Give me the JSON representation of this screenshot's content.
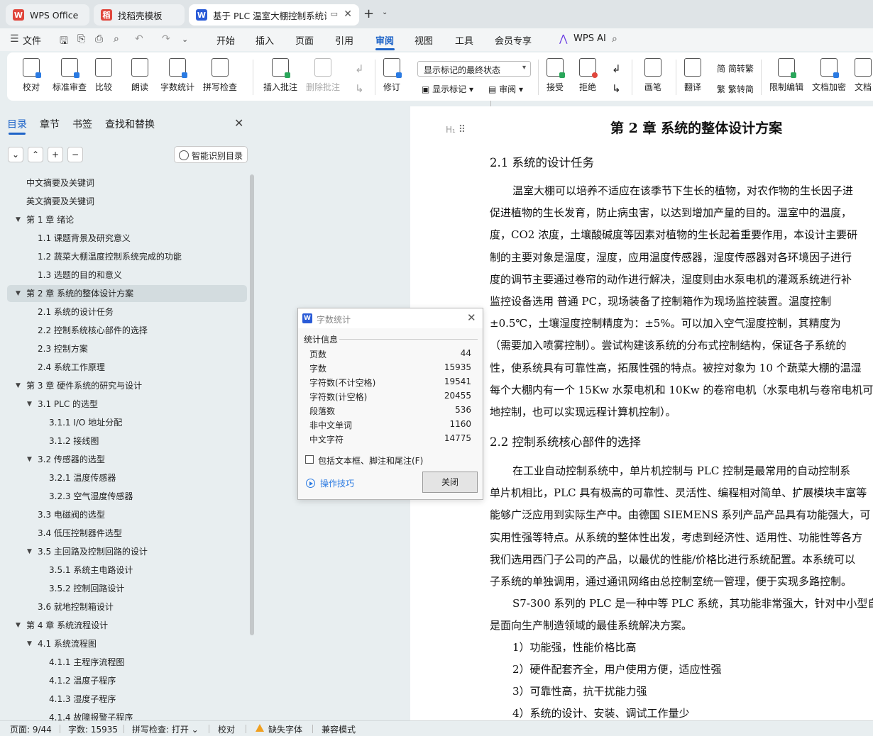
{
  "tabs": [
    {
      "label": "WPS Office",
      "logo": "W",
      "color": "#e0463c"
    },
    {
      "label": "找稻壳模板",
      "logo": "稻",
      "color": "#e0463c"
    },
    {
      "label": "基于 PLC 温室大棚控制系统设",
      "logo": "W",
      "color": "#2a5bd7"
    }
  ],
  "menubar": {
    "file": "文件",
    "items": [
      "开始",
      "插入",
      "页面",
      "引用",
      "审阅",
      "视图",
      "工具",
      "会员专享"
    ],
    "wps_ai": "WPS AI"
  },
  "ribbon": {
    "proofread": "校对",
    "standard_review": "标准审查",
    "compare": "比较",
    "read_aloud": "朗读",
    "word_count": "字数统计",
    "spell_check": "拼写检查",
    "insert_comment": "插入批注",
    "delete_comment": "删除批注",
    "revise": "修订",
    "markup_select": "显示标记的最终状态",
    "show_markup": "显示标记",
    "review": "审阅",
    "accept": "接受",
    "reject": "拒绝",
    "brush": "画笔",
    "translate": "翻译",
    "to_traditional": "简转繁",
    "to_simplified": "繁转简",
    "restrict_edit": "限制编辑",
    "encrypt": "文档加密",
    "doc_more": "文档"
  },
  "panel": {
    "tabs": [
      "目录",
      "章节",
      "书签",
      "查找和替换"
    ],
    "smart_toc": "智能识别目录",
    "toc": [
      {
        "label": "中文摘要及关键词",
        "level": 0,
        "tri": false
      },
      {
        "label": "英文摘要及关键词",
        "level": 0,
        "tri": false
      },
      {
        "label": "第 1 章  绪论",
        "level": 0,
        "tri": true
      },
      {
        "label": "1.1  课题背景及研究意义",
        "level": 1,
        "tri": false
      },
      {
        "label": "1.2  蔬菜大棚温度控制系统完成的功能",
        "level": 1,
        "tri": false
      },
      {
        "label": "1.3  选题的目的和意义",
        "level": 1,
        "tri": false
      },
      {
        "label": "第 2 章  系统的整体设计方案",
        "level": 0,
        "tri": true,
        "selected": true
      },
      {
        "label": "2.1 系统的设计任务",
        "level": 1,
        "tri": false
      },
      {
        "label": "2.2  控制系统核心部件的选择",
        "level": 1,
        "tri": false
      },
      {
        "label": "2.3 控制方案",
        "level": 1,
        "tri": false
      },
      {
        "label": "2.4 系统工作原理",
        "level": 1,
        "tri": false
      },
      {
        "label": "第 3 章  硬件系统的研究与设计",
        "level": 0,
        "tri": true
      },
      {
        "label": "3.1 PLC 的选型",
        "level": 1,
        "tri": true
      },
      {
        "label": "3.1.1 I/O 地址分配",
        "level": 2,
        "tri": false
      },
      {
        "label": "3.1.2  接线图",
        "level": 2,
        "tri": false
      },
      {
        "label": "3.2  传感器的选型",
        "level": 1,
        "tri": true
      },
      {
        "label": "3.2.1 温度传感器",
        "level": 2,
        "tri": false
      },
      {
        "label": "3.2.3  空气湿度传感器",
        "level": 2,
        "tri": false
      },
      {
        "label": "3.3  电磁阀的选型",
        "level": 1,
        "tri": false
      },
      {
        "label": "3.4 低压控制器件选型",
        "level": 1,
        "tri": false
      },
      {
        "label": "3.5 主回路及控制回路的设计",
        "level": 1,
        "tri": true
      },
      {
        "label": "3.5.1  系统主电路设计",
        "level": 2,
        "tri": false
      },
      {
        "label": "3.5.2  控制回路设计",
        "level": 2,
        "tri": false
      },
      {
        "label": "3.6  就地控制箱设计",
        "level": 1,
        "tri": false
      },
      {
        "label": "第 4 章  系统流程设计",
        "level": 0,
        "tri": true
      },
      {
        "label": "4.1 系统流程图",
        "level": 1,
        "tri": true
      },
      {
        "label": "4.1.1  主程序流程图",
        "level": 2,
        "tri": false
      },
      {
        "label": "4.1.2  温度子程序",
        "level": 2,
        "tri": false
      },
      {
        "label": "4.1.3  湿度子程序",
        "level": 2,
        "tri": false
      },
      {
        "label": "4.1.4  故障报警子程序",
        "level": 2,
        "tri": false
      }
    ]
  },
  "document": {
    "h1_marker": "H₁",
    "chapter_title": "第 2 章  系统的整体设计方案",
    "section1": "2.1 系统的设计任务",
    "para1": [
      "温室大棚可以培养不适应在该季节下生长的植物，对农作物的生长因子进",
      "促进植物的生长发育，防止病虫害，以达到增加产量的目的。温室中的温度，",
      "度，CO2 浓度，土壤酸碱度等因素对植物的生长起着重要作用，本设计主要研",
      "制的主要对象是温度，湿度，应用温度传感器，湿度传感器对各环境因子进行",
      "度的调节主要通过卷帘的动作进行解决，湿度则由水泵电机的灌溉系统进行补",
      "监控设备选用 普通 PC，现场装备了控制箱作为现场监控装置。温度控制",
      "±0.5℃，土壤湿度控制精度为：±5%。可以加入空气湿度控制，其精度为",
      "（需要加入喷雾控制）。尝试构建该系统的分布式控制结构，保证各子系统的",
      "性，使系统具有可靠性高，拓展性强的特点。被控对象为 10 个蔬菜大棚的温湿",
      "每个大棚内有一个 15Kw 水泵电机和 10Kw 的卷帘电机（水泵电机与卷帘电机可",
      "地控制，也可以实现远程计算机控制）。"
    ],
    "section2": "2.2  控制系统核心部件的选择",
    "para2": [
      "在工业自动控制系统中，单片机控制与 PLC 控制是最常用的自动控制系",
      "单片机相比，PLC 具有极高的可靠性、灵活性、编程相对简单、扩展模块丰富等",
      "能够广泛应用到实际生产中。由德国 SIEMENS 系列产品产品具有功能强大，可",
      "实用性强等特点。从系统的整体性出发，考虑到经济性、适用性、功能性等各方",
      "我们选用西门子公司的产品，以最优的性能/价格比进行系统配置。本系统可以",
      "子系统的单独调用，通过通讯网络由总控制室统一管理，便于实现多路控制。"
    ],
    "para3": [
      "S7-300 系列的 PLC 是一种中等 PLC 系统，其功能非常强大，针对中小型自",
      "是面向生产制造领域的最佳系统解决方案。"
    ],
    "list": [
      "1）功能强，性能价格比高",
      "2）硬件配套齐全，用户使用方便，适应性强",
      "3）可靠性高，抗干扰能力强",
      "4）系统的设计、安装、调试工作量少"
    ]
  },
  "dialog": {
    "title": "字数统计",
    "section": "统计信息",
    "stats": [
      {
        "label": "页数",
        "value": "44"
      },
      {
        "label": "字数",
        "value": "15935"
      },
      {
        "label": "字符数(不计空格)",
        "value": "19541"
      },
      {
        "label": "字符数(计空格)",
        "value": "20455"
      },
      {
        "label": "段落数",
        "value": "536"
      },
      {
        "label": "非中文单词",
        "value": "1160"
      },
      {
        "label": "中文字符",
        "value": "14775"
      }
    ],
    "checkbox_label": "包括文本框、脚注和尾注(F)",
    "tips": "操作技巧",
    "close": "关闭"
  },
  "status": {
    "page": "页面: 9/44",
    "words": "字数: 15935",
    "spell": "拼写检查: 打开",
    "proof": "校对",
    "missing_font": "缺失字体",
    "compat": "兼容模式"
  }
}
